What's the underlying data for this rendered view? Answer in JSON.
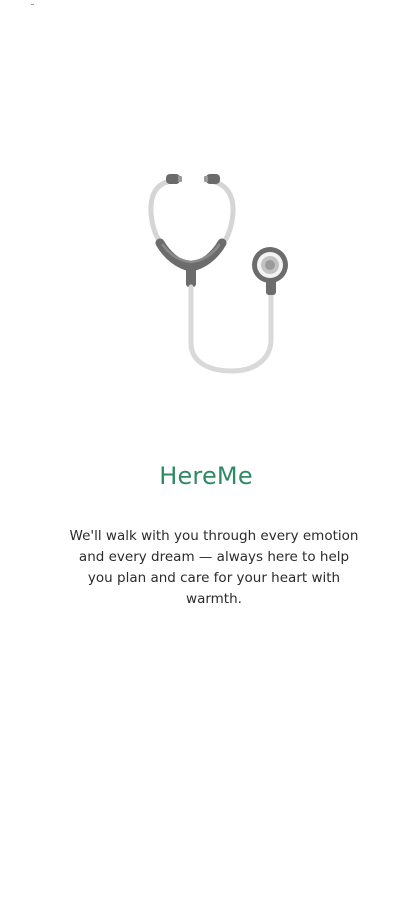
{
  "app": {
    "title": "HereMe",
    "description": "We'll walk with you through every emotion and every dream — always here to help you plan and care for your heart with warmth."
  },
  "illustration": {
    "icon": "stethoscope-icon"
  },
  "colors": {
    "background": "#ffffff",
    "accent": "#2f8a64",
    "text": "#2b2b2b",
    "illustration_dark": "#6f6f6f",
    "illustration_light": "#d9d9d9"
  }
}
